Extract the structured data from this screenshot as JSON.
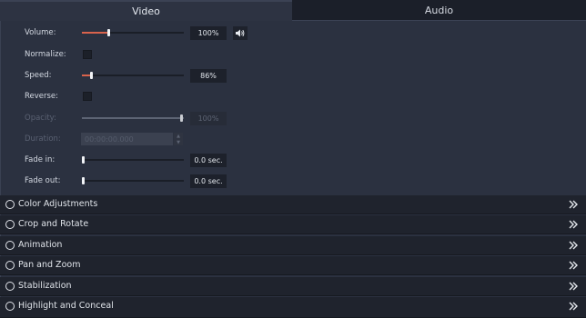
{
  "tabs": {
    "video": "Video",
    "audio": "Audio"
  },
  "rows": {
    "volume": {
      "label": "Volume:",
      "value": "100%",
      "level": 0.26
    },
    "normalize": {
      "label": "Normalize:",
      "checked": false
    },
    "speed": {
      "label": "Speed:",
      "value": "86%",
      "level": 0.08
    },
    "reverse": {
      "label": "Reverse:",
      "checked": false
    },
    "opacity": {
      "label": "Opacity:",
      "value": "100%",
      "level": 1.0,
      "disabled": true
    },
    "duration": {
      "label": "Duration:",
      "value": "00:00:00.000",
      "disabled": true
    },
    "fade_in": {
      "label": "Fade in:",
      "value": "0.0 sec.",
      "level": 0.0
    },
    "fade_out": {
      "label": "Fade out:",
      "value": "0.0 sec.",
      "level": 0.0
    }
  },
  "sections": [
    {
      "label": "Color Adjustments"
    },
    {
      "label": "Crop and Rotate"
    },
    {
      "label": "Animation"
    },
    {
      "label": "Pan and Zoom"
    },
    {
      "label": "Stabilization"
    },
    {
      "label": "Highlight and Conceal"
    }
  ],
  "icons": {
    "speaker": "speaker-icon",
    "expand": "double-chevron-right-icon",
    "radio": "radio-circle-icon"
  },
  "colors": {
    "accent": "#d9634c",
    "panel_bg": "#2b3140",
    "section_bg": "#1f232d"
  }
}
